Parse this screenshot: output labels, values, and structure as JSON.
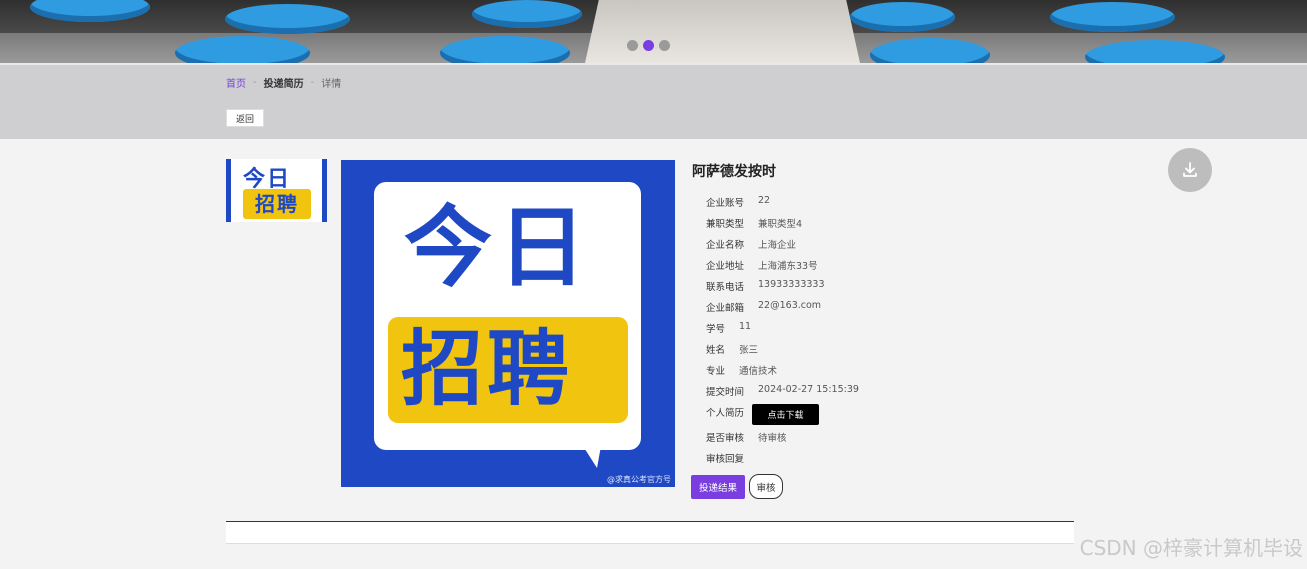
{
  "banner": {
    "carousel_dots": [
      false,
      true,
      false
    ],
    "accent": "#7a3ee0"
  },
  "breadcrumb": {
    "home": "首页",
    "sep": "-",
    "section": "投递简历",
    "current": "详情"
  },
  "back_button": "返回",
  "images": {
    "thumb_line1": "今日",
    "thumb_line2": "招聘",
    "main_line1": "今日",
    "main_line2": "招聘",
    "main_watermark": "@求真公考官方号"
  },
  "detail": {
    "title": "阿萨德发按时",
    "fields": [
      {
        "label": "企业账号",
        "value": "22"
      },
      {
        "label": "兼职类型",
        "value": "兼职类型4"
      },
      {
        "label": "企业名称",
        "value": "上海企业"
      },
      {
        "label": "企业地址",
        "value": "上海浦东33号"
      },
      {
        "label": "联系电话",
        "value": "13933333333"
      },
      {
        "label": "企业邮箱",
        "value": "22@163.com"
      },
      {
        "label": "学号",
        "value": "11"
      },
      {
        "label": "姓名",
        "value": "张三"
      },
      {
        "label": "专业",
        "value": "通信技术"
      },
      {
        "label": "提交时间",
        "value": "2024-02-27 15:15:39"
      },
      {
        "label": "个人简历",
        "value": ""
      },
      {
        "label": "是否审核",
        "value": "待审核"
      },
      {
        "label": "审核回复",
        "value": ""
      }
    ],
    "download_label": "点击下载",
    "result_button": "投递结果",
    "review_button": "审核"
  },
  "download_icon": "download-icon",
  "watermark": "CSDN @梓豪计算机毕设"
}
